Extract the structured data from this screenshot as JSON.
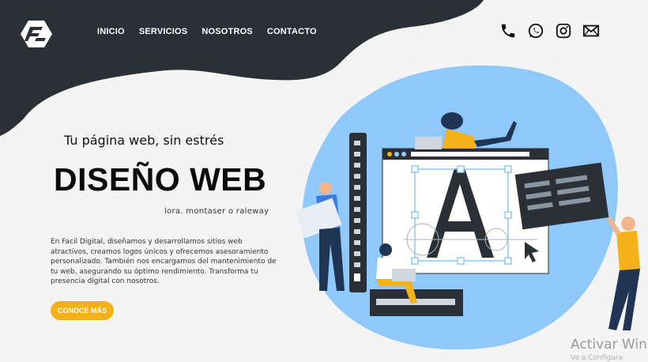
{
  "nav": {
    "items": [
      {
        "label": "INICIO"
      },
      {
        "label": "SERVICIOS"
      },
      {
        "label": "NOSOTROS"
      },
      {
        "label": "CONTACTO"
      }
    ]
  },
  "social": {
    "icons": [
      "phone-icon",
      "whatsapp-icon",
      "instagram-icon",
      "mail-icon"
    ]
  },
  "hero": {
    "tagline": "Tu página web, sin estrés",
    "headline": "DISEÑO WEB",
    "font_note": "lora. montaser o raleway",
    "description": "En Facil Digital, diseñamos y desarrollamos sitios web atractivos, creamos logos únicos y ofrecemos asesoramiento personalizado. También nos encargamos del mantenimiento de tu web, asegurando su óptimo rendimiento. Transforma tu presencia digital con nosotros.",
    "cta_label": "CONOCE MÁS"
  },
  "watermark": {
    "line1": "Activar Win",
    "line2": "Ve a Configura"
  },
  "colors": {
    "header_dark": "#2b2f36",
    "accent_blue": "#8fc8fb",
    "cta_yellow": "#f4b21a"
  }
}
